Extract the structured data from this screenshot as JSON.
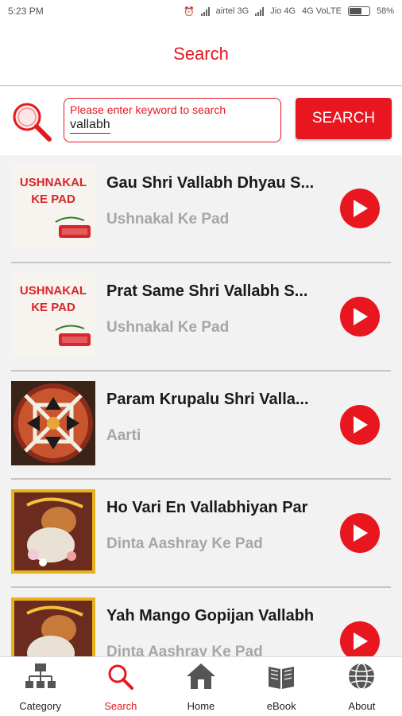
{
  "status_bar": {
    "time": "5:23 PM",
    "carrier1": "airtel 3G",
    "carrier2": "Jio 4G",
    "network": "4G VoLTE",
    "battery": "58%"
  },
  "header": {
    "title": "Search"
  },
  "search": {
    "placeholder": "Please enter keyword to search",
    "value": "vallabh",
    "button_label": "SEARCH"
  },
  "results": [
    {
      "title": "Gau Shri Vallabh Dhyau S...",
      "album": "Ushnakal Ke Pad",
      "thumb": "ushnakal",
      "thumb_text": [
        "USHNAKAL",
        "KE PAD"
      ]
    },
    {
      "title": "Prat Same Shri Vallabh S...",
      "album": "Ushnakal Ke Pad",
      "thumb": "ushnakal",
      "thumb_text": [
        "USHNAKAL",
        "KE PAD"
      ]
    },
    {
      "title": "Param Krupalu Shri Valla...",
      "album": "Aarti",
      "thumb": "aarti"
    },
    {
      "title": "Ho Vari En Vallabhiyan Par",
      "album": "Dinta Aashray Ke Pad",
      "thumb": "deity"
    },
    {
      "title": "Yah Mango Gopijan Vallabh",
      "album": "Dinta Aashray Ke Pad",
      "thumb": "deity"
    }
  ],
  "bottom_nav": [
    {
      "label": "Category",
      "icon": "category-icon",
      "active": false
    },
    {
      "label": "Search",
      "icon": "search-icon",
      "active": true
    },
    {
      "label": "Home",
      "icon": "home-icon",
      "active": false
    },
    {
      "label": "eBook",
      "icon": "ebook-icon",
      "active": false
    },
    {
      "label": "About",
      "icon": "globe-icon",
      "active": false
    }
  ],
  "colors": {
    "accent": "#e8161f",
    "muted_text": "#a6a6a6",
    "background": "#f2f2f2"
  }
}
